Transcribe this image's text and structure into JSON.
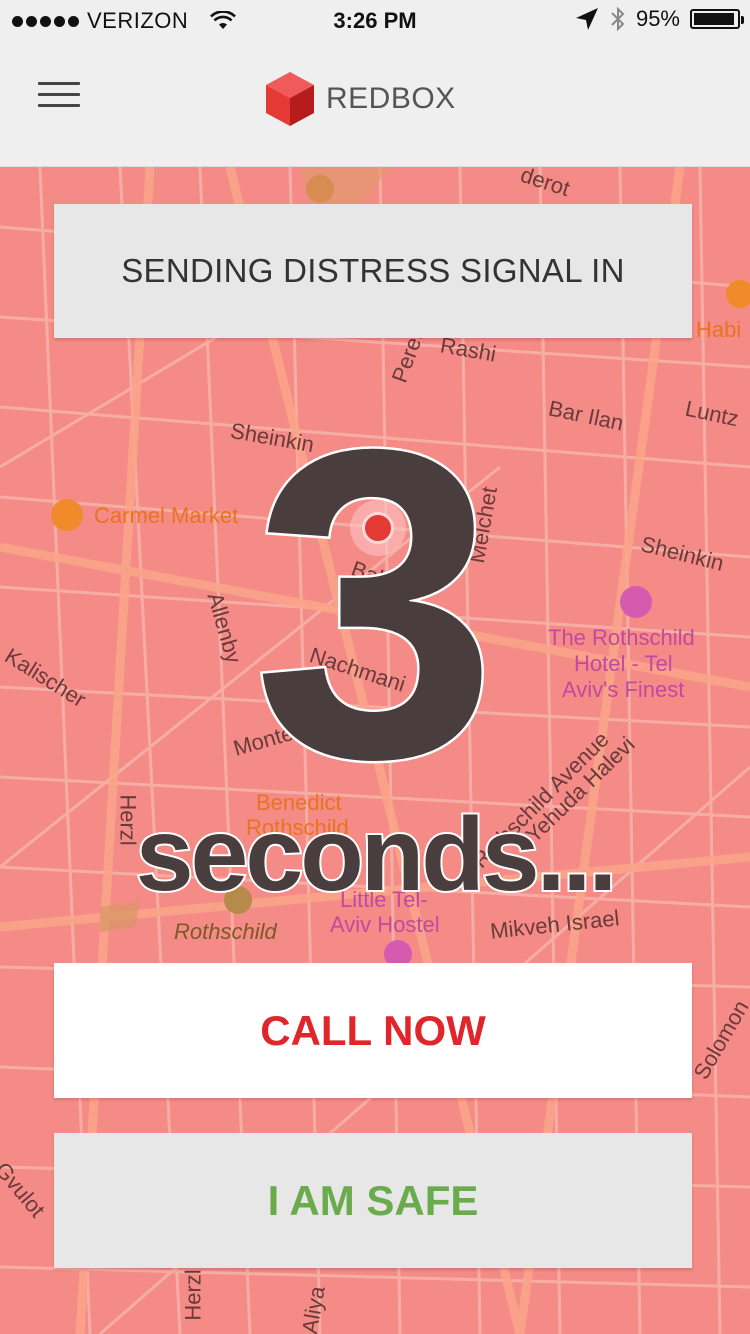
{
  "status_bar": {
    "carrier": "VERIZON",
    "time": "3:26 PM",
    "battery": "95%",
    "battery_level": 0.95
  },
  "nav": {
    "brand": "REDBOX"
  },
  "map_labels": {
    "sheinkin_1": "Sheinkin",
    "sheinkin_2": "Sheinkin",
    "bar_ilan": "Bar Ilan",
    "luntz": "Luntz",
    "rashi": "Rashi",
    "allenby": "Allenby",
    "nachmani": "Nachmani",
    "balfour": "Balfour",
    "melchet": "Melchet",
    "kalischer": "Kalischer",
    "montefiore": "Montefiore",
    "herzl": "Herzl",
    "rothschild_avenue": "Rothschild Avenue",
    "yehuda_halevi": "Yehuda Halevi",
    "mikveh_israel": "Mikveh Israel",
    "solomon": "Solomon",
    "gvulot": "Gvulot",
    "aliya": "Aliya",
    "herzl_2": "Herzl",
    "derot": "derot",
    "perets": "Peretz"
  },
  "pois": {
    "carmel_market": "Carmel Market",
    "rothschild_hotel_line1": "The Rothschild",
    "rothschild_hotel_line2": "Hotel - Tel",
    "rothschild_hotel_line3": "Aviv's Finest",
    "benedict_line1": "Benedict",
    "benedict_line2": "Rothschild",
    "hostel_line1": "Little Tel-",
    "hostel_line2": "Aviv Hostel",
    "rothschild_park": "Rothschild",
    "habima": "Habi"
  },
  "alert": {
    "header": "SENDING DISTRESS SIGNAL IN",
    "count": "3",
    "unit": "seconds..."
  },
  "actions": {
    "call_now": "CALL NOW",
    "i_am_safe": "I AM SAFE"
  },
  "colors": {
    "map_overlay": "#f48b87",
    "call_text": "#e0262a",
    "safe_text": "#6aab4e",
    "brand_cube": "#e53935"
  }
}
